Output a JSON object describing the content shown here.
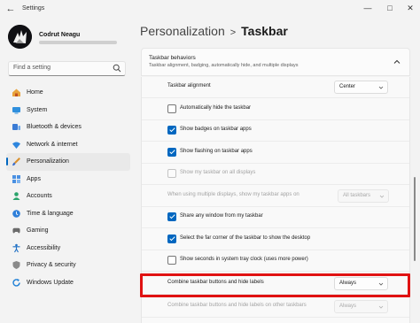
{
  "window": {
    "title": "Settings",
    "controls": [
      "minimize-icon",
      "maximize-icon",
      "close-icon"
    ]
  },
  "profile": {
    "name": "Codrut Neagu"
  },
  "search": {
    "placeholder": "Find a setting",
    "icon": "search-icon"
  },
  "nav": {
    "active_index": 4,
    "accent": "#0067c0",
    "items": [
      {
        "label": "Home",
        "icon": "home-icon"
      },
      {
        "label": "System",
        "icon": "system-icon"
      },
      {
        "label": "Bluetooth & devices",
        "icon": "bluetooth-icon"
      },
      {
        "label": "Network & internet",
        "icon": "wifi-icon"
      },
      {
        "label": "Personalization",
        "icon": "brush-icon"
      },
      {
        "label": "Apps",
        "icon": "apps-icon"
      },
      {
        "label": "Accounts",
        "icon": "accounts-icon"
      },
      {
        "label": "Time & language",
        "icon": "clock-icon"
      },
      {
        "label": "Gaming",
        "icon": "gamepad-icon"
      },
      {
        "label": "Accessibility",
        "icon": "accessibility-icon"
      },
      {
        "label": "Privacy & security",
        "icon": "shield-icon"
      },
      {
        "label": "Windows Update",
        "icon": "update-icon"
      }
    ]
  },
  "breadcrumb": {
    "parent": "Personalization",
    "separator": ">",
    "current": "Taskbar"
  },
  "section": {
    "title": "Taskbar behaviors",
    "subtitle": "Taskbar alignment, badging, automatically hide, and multiple displays"
  },
  "rows": [
    {
      "label": "Taskbar alignment",
      "control": "dropdown",
      "value": "Center",
      "disabled": false
    },
    {
      "label": "Automatically hide the taskbar",
      "control": "checkbox",
      "checked": false,
      "disabled": false
    },
    {
      "label": "Show badges on taskbar apps",
      "control": "checkbox",
      "checked": true,
      "disabled": false
    },
    {
      "label": "Show flashing on taskbar apps",
      "control": "checkbox",
      "checked": true,
      "disabled": false
    },
    {
      "label": "Show my taskbar on all displays",
      "control": "checkbox",
      "checked": false,
      "disabled": true
    },
    {
      "label": "When using multiple displays, show my taskbar apps on",
      "control": "dropdown",
      "value": "All taskbars",
      "disabled": true
    },
    {
      "label": "Share any window from my taskbar",
      "control": "checkbox",
      "checked": true,
      "disabled": false
    },
    {
      "label": "Select the far corner of the taskbar to show the desktop",
      "control": "checkbox",
      "checked": true,
      "disabled": false
    },
    {
      "label": "Show seconds in system tray clock (uses more power)",
      "control": "checkbox",
      "checked": false,
      "disabled": false
    },
    {
      "label": "Combine taskbar buttons and hide labels",
      "control": "dropdown",
      "value": "Always",
      "disabled": false,
      "highlighted": true
    },
    {
      "label": "Combine taskbar buttons and hide labels on other taskbars",
      "control": "dropdown",
      "value": "Always",
      "disabled": true
    }
  ],
  "colors": {
    "accent": "#0067c0",
    "highlight_border": "#e01212"
  }
}
